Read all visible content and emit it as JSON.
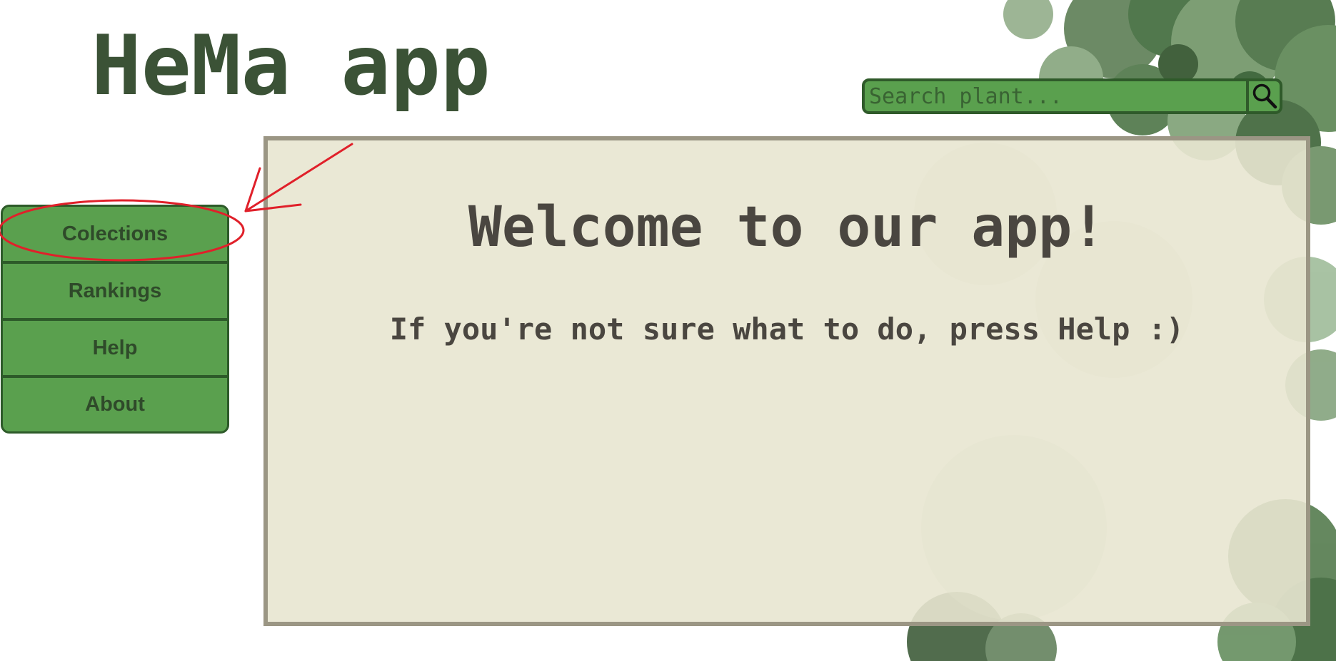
{
  "app": {
    "title": "HeMa app"
  },
  "search": {
    "placeholder": "Search plant...",
    "button_icon": "search-icon"
  },
  "sidebar": {
    "items": [
      {
        "label": "Colections"
      },
      {
        "label": "Rankings"
      },
      {
        "label": "Help"
      },
      {
        "label": "About"
      }
    ]
  },
  "main": {
    "heading": "Welcome to our app!",
    "subtitle": "If you're not sure what to do, press Help :)"
  },
  "annotation": {
    "shape": "red-ellipse-and-arrow",
    "target": "Colections",
    "color": "#e0202a"
  },
  "colors": {
    "title": "#3b5236",
    "nav_green": "#5aa04e",
    "nav_border": "#2d5a29",
    "panel_bg": "#e8e6d0",
    "panel_border": "#9b9684",
    "panel_text": "#4a4640"
  },
  "background": {
    "decoration": "succulent-plants"
  }
}
